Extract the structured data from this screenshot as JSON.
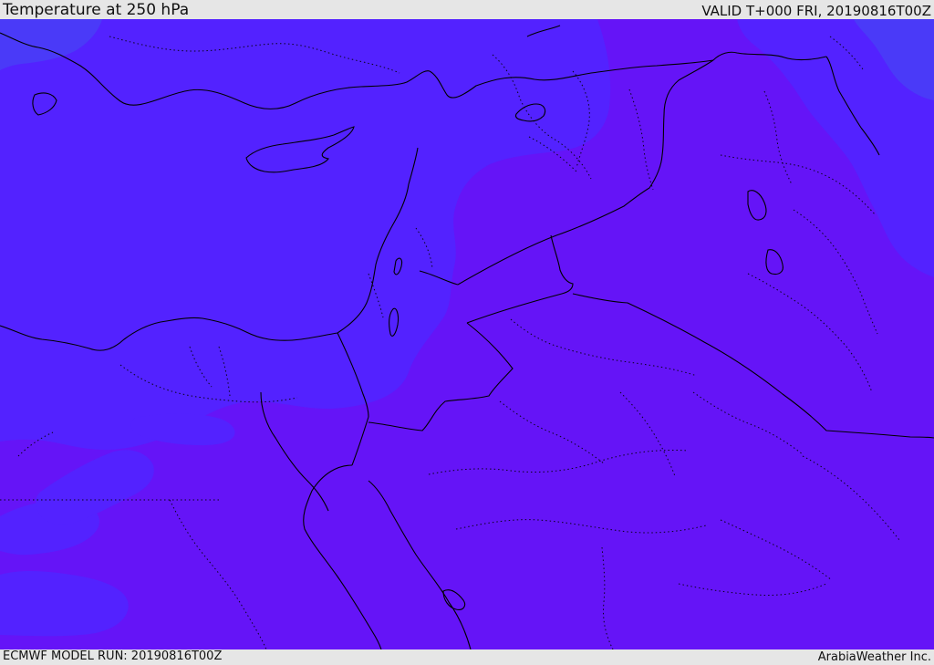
{
  "header": {
    "title": "Temperature at 250 hPa",
    "valid_time": "VALID T+000 FRI, 20190816T00Z"
  },
  "footer": {
    "model_run": "ECMWF MODEL RUN: 20190816T00Z",
    "credit": "ArabiaWeather Inc."
  },
  "map": {
    "field": "temperature",
    "colors": {
      "dominant_fill": "#6514f7",
      "cooler_fill": "#5322ff",
      "coolest_fill": "#4a3af8",
      "boundary_line": "#000000"
    }
  }
}
